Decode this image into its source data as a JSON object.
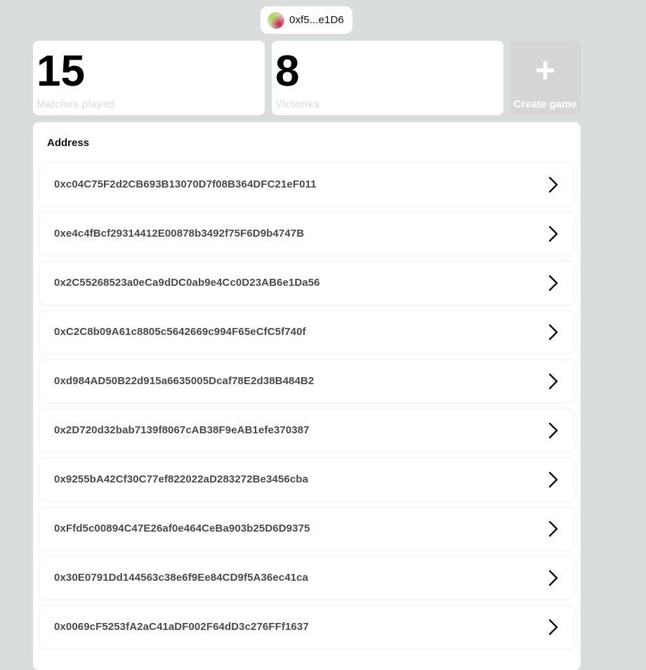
{
  "wallet": {
    "address_short": "0xf5...e1D6"
  },
  "stats": {
    "matches_played": {
      "value": "15",
      "label": "Matches played"
    },
    "victories": {
      "value": "8",
      "label": "Victories"
    }
  },
  "create_game": {
    "icon": "plus-icon",
    "label": "Create game"
  },
  "list": {
    "header": "Address",
    "row_icon": "chevron-right-icon",
    "rows": [
      "0xc04C75F2d2CB693B13070D7f08B364DFC21eF011",
      "0xe4c4fBcf29314412E00878b3492f75F6D9b4747B",
      "0x2C55268523a0eCa9dDC0ab9e4Cc0D23AB6e1Da56",
      "0xC2C8b09A61c8805c5642669c994F65eCfC5f740f",
      "0xd984AD50B22d915a6635005Dcaf78E2d38B484B2",
      "0x2D720d32bab7139f8067cAB38F9eAB1efe370387",
      "0x9255bA42Cf30C77ef822022aD283272Be3456cba",
      "0xFfd5c00894C47E26af0e464CeBa903b25D6D9375",
      "0x30E0791Dd144563c38e6f9Ee84CD9f5A36ec41ca",
      "0x0069cF5253fA2aC41aDF002F64dD3c276FFf1637"
    ]
  },
  "colors": {
    "page_background": "#d9dddc",
    "card_background": "#ffffff",
    "create_card_background": "#d6d6d6",
    "stat_label": "#e3e3e3",
    "row_text": "#4a4a4a"
  }
}
